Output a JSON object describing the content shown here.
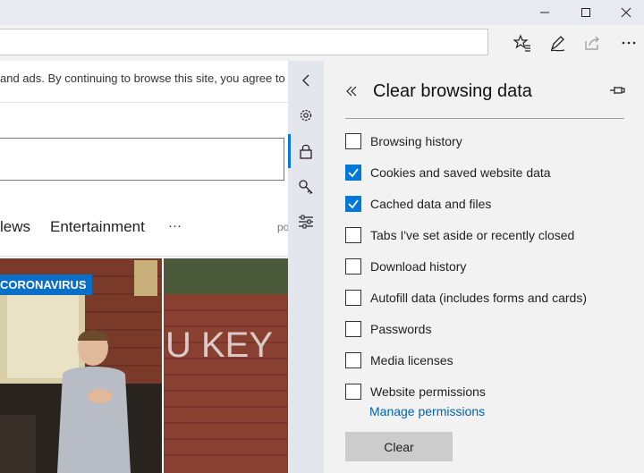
{
  "colors": {
    "accent": "#0078d7",
    "badge": "#0a6fc7",
    "link": "#0063b1"
  },
  "window_controls": {
    "minimize_icon": "minimize-icon",
    "maximize_icon": "maximize-icon",
    "close_icon": "close-icon"
  },
  "toolbar": {
    "icons": [
      "favorites-star-icon",
      "pen-icon",
      "share-icon",
      "more-icon"
    ]
  },
  "page": {
    "cookie_notice": "and ads. By continuing to browse this site, you agree to t",
    "nav": [
      "lews",
      "Entertainment",
      "···",
      "po"
    ],
    "badge": "CORONAVIRUS",
    "graffiti": "U KEY"
  },
  "sidebar_strip": {
    "icons": [
      "back-chevron-icon",
      "settings-gear-icon",
      "privacy-lock-icon",
      "passwords-key-icon",
      "advanced-sliders-icon"
    ]
  },
  "panel": {
    "title": "Clear browsing data",
    "options": [
      {
        "label": "Browsing history",
        "checked": false
      },
      {
        "label": "Cookies and saved website data",
        "checked": true
      },
      {
        "label": "Cached data and files",
        "checked": true
      },
      {
        "label": "Tabs I've set aside or recently closed",
        "checked": false
      },
      {
        "label": "Download history",
        "checked": false
      },
      {
        "label": "Autofill data (includes forms and cards)",
        "checked": false
      },
      {
        "label": "Passwords",
        "checked": false
      },
      {
        "label": "Media licenses",
        "checked": false
      },
      {
        "label": "Website permissions",
        "checked": false
      }
    ],
    "manage_link": "Manage permissions",
    "clear_button": "Clear"
  }
}
